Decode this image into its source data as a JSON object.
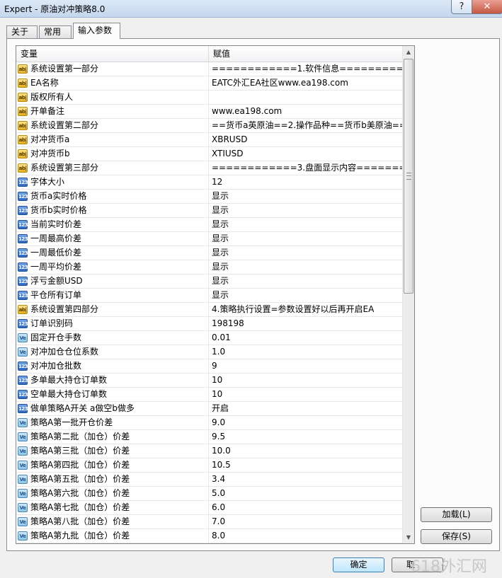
{
  "window": {
    "title": "Expert - 原油对冲策略8.0",
    "help_glyph": "?",
    "close_glyph": "✕"
  },
  "tabs": [
    {
      "label": "关于"
    },
    {
      "label": "常用"
    },
    {
      "label": "输入参数"
    }
  ],
  "grid": {
    "header_variable": "变量",
    "header_value": "赋值",
    "rows": [
      {
        "icon": "ab",
        "name": "系统设置第一部分",
        "value": "============1.软件信息==========="
      },
      {
        "icon": "ab",
        "name": "EA名称",
        "value": "EATC外汇EA社区www.ea198.com"
      },
      {
        "icon": "ab",
        "name": "版权所有人",
        "value": ""
      },
      {
        "icon": "ab",
        "name": "开单备注",
        "value": "www.ea198.com"
      },
      {
        "icon": "ab",
        "name": "系统设置第二部分",
        "value": "==货币a英原油==2.操作品种==货币b美原油=="
      },
      {
        "icon": "ab",
        "name": "对冲货币a",
        "value": "XBRUSD"
      },
      {
        "icon": "ab",
        "name": "对冲货币b",
        "value": "XTIUSD"
      },
      {
        "icon": "ab",
        "name": "系统设置第三部分",
        "value": "============3.盘面显示内容=========="
      },
      {
        "icon": "123",
        "name": "字体大小",
        "value": "12"
      },
      {
        "icon": "123",
        "name": "货币a实时价格",
        "value": "显示"
      },
      {
        "icon": "123",
        "name": "货币b实时价格",
        "value": "显示"
      },
      {
        "icon": "123",
        "name": "当前实时价差",
        "value": "显示"
      },
      {
        "icon": "123",
        "name": "一周最高价差",
        "value": "显示"
      },
      {
        "icon": "123",
        "name": "一周最低价差",
        "value": "显示"
      },
      {
        "icon": "123",
        "name": "一周平均价差",
        "value": "显示"
      },
      {
        "icon": "123",
        "name": "浮亏金额USD",
        "value": "显示"
      },
      {
        "icon": "123",
        "name": "平仓所有订单",
        "value": "显示"
      },
      {
        "icon": "ab",
        "name": "系统设置第四部分",
        "value": "4.策略执行设置=参数设置好以后再开启EA"
      },
      {
        "icon": "123",
        "name": "订单识别码",
        "value": "198198"
      },
      {
        "icon": "ve",
        "name": "固定开仓手数",
        "value": "0.01"
      },
      {
        "icon": "ve",
        "name": "对冲加仓仓位系数",
        "value": "1.0"
      },
      {
        "icon": "123",
        "name": "对冲加仓批数",
        "value": "9"
      },
      {
        "icon": "123",
        "name": "多单最大持仓订单数",
        "value": "10"
      },
      {
        "icon": "123",
        "name": "空单最大持仓订单数",
        "value": "10"
      },
      {
        "icon": "123",
        "name": "做单策略A开关  a做空b做多",
        "value": "开启"
      },
      {
        "icon": "ve",
        "name": "策略A第一批开仓价差",
        "value": "9.0"
      },
      {
        "icon": "ve",
        "name": "策略A第二批（加仓）价差",
        "value": "9.5"
      },
      {
        "icon": "ve",
        "name": "策略A第三批（加仓）价差",
        "value": "10.0"
      },
      {
        "icon": "ve",
        "name": "策略A第四批（加仓）价差",
        "value": "10.5"
      },
      {
        "icon": "ve",
        "name": "策略A第五批（加仓）价差",
        "value": "3.4"
      },
      {
        "icon": "ve",
        "name": "策略A第六批（加仓）价差",
        "value": "5.0"
      },
      {
        "icon": "ve",
        "name": "策略A第七批（加仓）价差",
        "value": "6.0"
      },
      {
        "icon": "ve",
        "name": "策略A第八批（加仓）价差",
        "value": "7.0"
      },
      {
        "icon": "ve",
        "name": "策略A第九批（加仓）价差",
        "value": "8.0"
      }
    ]
  },
  "buttons": {
    "load": "加载(L)",
    "save": "保存(S)",
    "ok": "确定",
    "cancel": "取"
  },
  "watermark": "618外汇网"
}
